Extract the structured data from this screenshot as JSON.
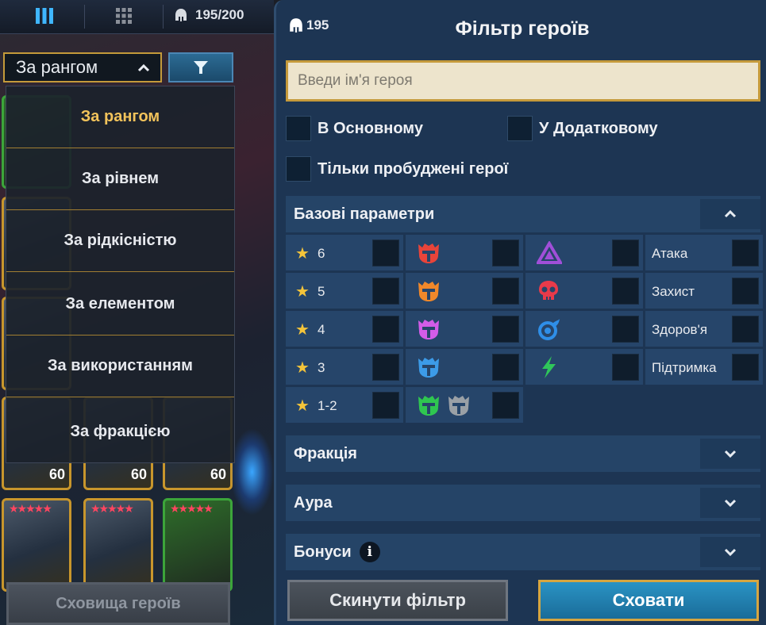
{
  "left": {
    "hero_count": "195/200",
    "sort_selected": "За рангом",
    "sort_options": [
      "За рангом",
      "За рівнем",
      "За рідкісністю",
      "За елементом",
      "За використанням",
      "За фракцією"
    ],
    "hero_levels": [
      "60",
      "60",
      "60"
    ],
    "vault_label": "Сховища героїв"
  },
  "filter": {
    "hero_count": "195",
    "title": "Фільтр героїв",
    "search_placeholder": "Введи ім'я героя",
    "chk_main": "В Основному",
    "chk_extra": "У Додатковому",
    "chk_awakened": "Тільки пробуджені герої",
    "section_base": "Базові параметри",
    "ranks": [
      "6",
      "5",
      "4",
      "3",
      "1-2"
    ],
    "stats": [
      "Атака",
      "Захист",
      "Здоров'я",
      "Підтримка"
    ],
    "section_faction": "Фракція",
    "section_aura": "Аура",
    "section_bonuses": "Бонуси",
    "reset_label": "Скинути фільтр",
    "hide_label": "Сховати"
  },
  "colors": {
    "rarity_legendary": "#e8443a",
    "rarity_epic_orange": "#f0882a",
    "rarity_epic": "#d35ce8",
    "rarity_rare": "#3c9be8",
    "rarity_uncommon": "#2fc650",
    "rarity_common": "#9aa0a6",
    "affinity_magic": "#a04fd8",
    "affinity_force": "#e83a4a",
    "affinity_spirit": "#2f8fe8",
    "affinity_void": "#2fc65a"
  }
}
